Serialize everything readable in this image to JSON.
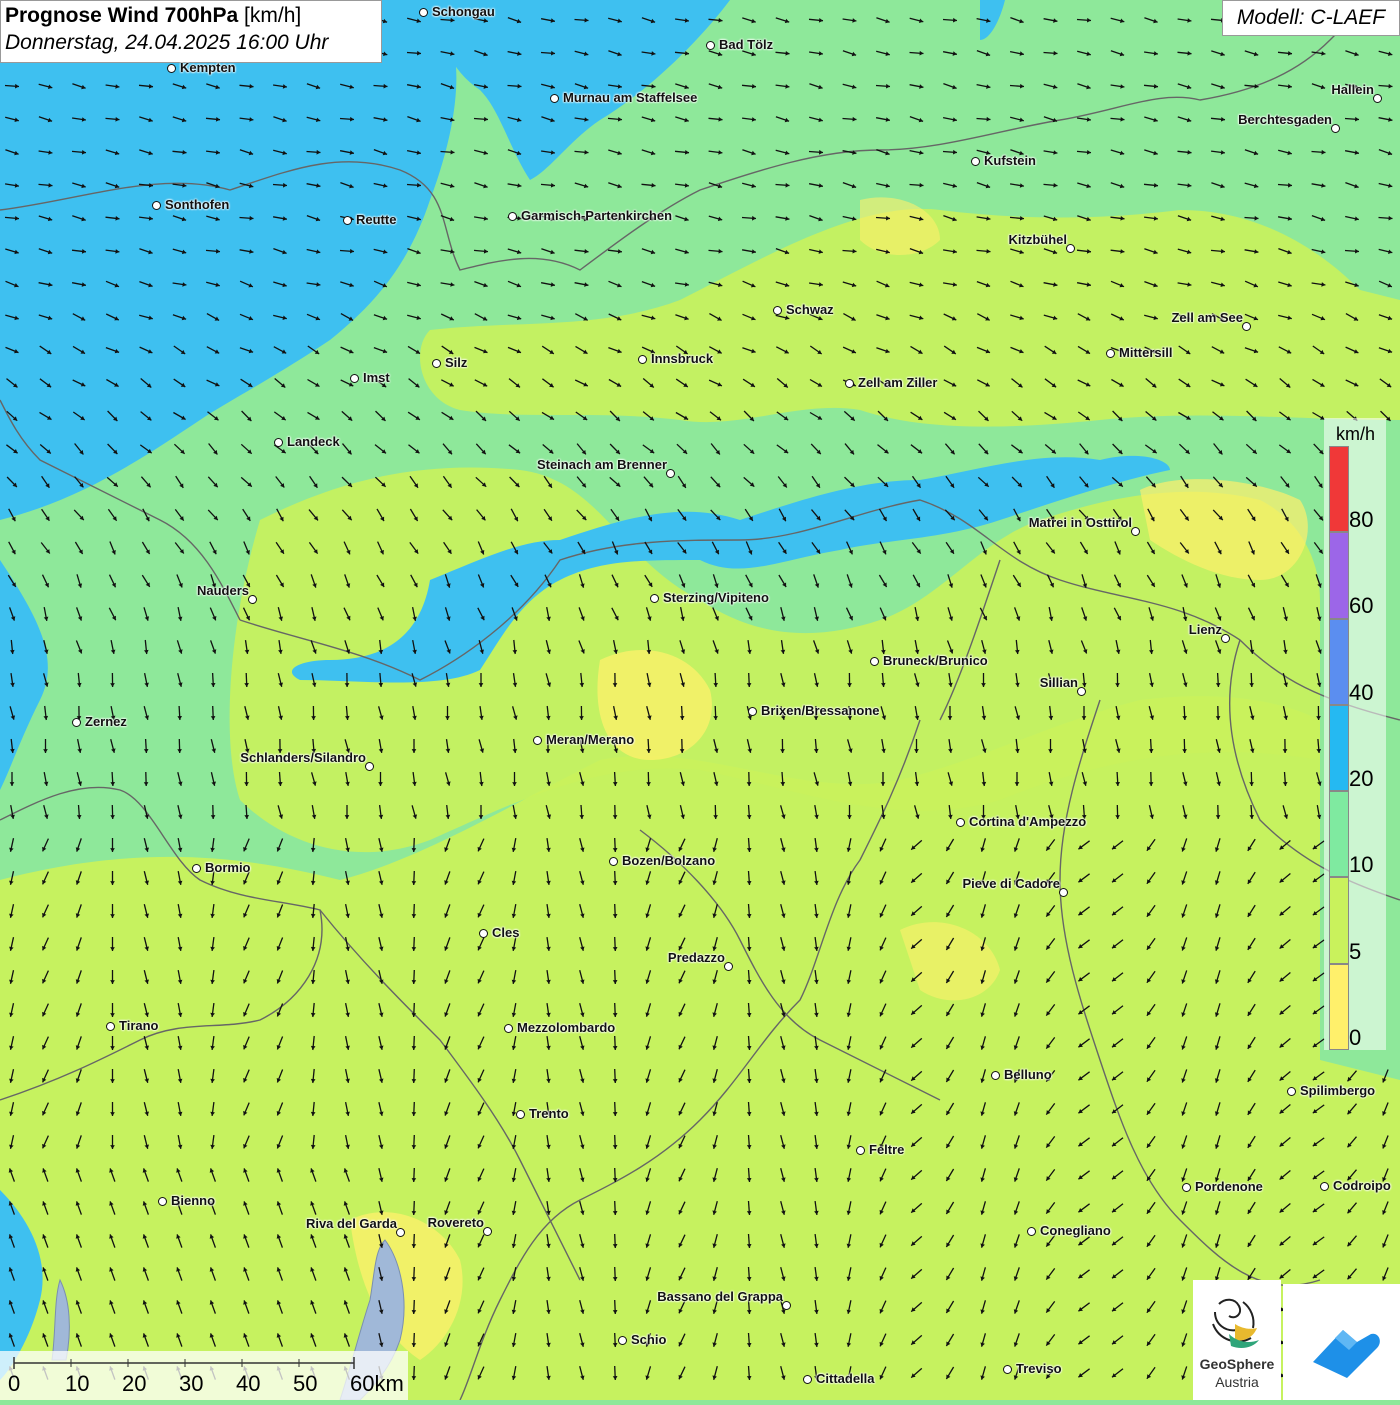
{
  "header": {
    "title_bold": "Prognose Wind 700hPa",
    "title_unit": "[km/h]",
    "datetime": "Donnerstag, 24.04.2025 16:00 Uhr",
    "model": "Modell: C-LAEF"
  },
  "legend": {
    "unit": "km/h",
    "classes": [
      {
        "min": 60,
        "max": 80,
        "color": "#9c66e8"
      },
      {
        "min": 40,
        "max": 60,
        "color": "#5b8ef0"
      },
      {
        "min": 20,
        "max": 40,
        "color": "#25b9f2"
      },
      {
        "min": 10,
        "max": 20,
        "color": "#7feaa0"
      },
      {
        "min": 5,
        "max": 10,
        "color": "#c9f25c"
      },
      {
        "min": 0,
        "max": 5,
        "color": "#fff06b"
      }
    ],
    "top_color": "#f03838",
    "labels": [
      "80",
      "60",
      "40",
      "20",
      "10",
      "5",
      "0"
    ]
  },
  "scale_bar": {
    "labels": [
      "0",
      "10",
      "20",
      "30",
      "40",
      "50",
      "60km"
    ]
  },
  "logo": {
    "name": "GeoSphere",
    "sub": "Austria",
    "icon": "geosphere-logo-icon",
    "secondary_icon": "warning-app-icon"
  },
  "cities": [
    {
      "name": "Schongau"
    },
    {
      "name": "Bad Tölz"
    },
    {
      "name": "Kempten"
    },
    {
      "name": "Murnau am Staffelsee"
    },
    {
      "name": "Hallein"
    },
    {
      "name": "Berchtesgaden"
    },
    {
      "name": "Kufstein"
    },
    {
      "name": "Sonthofen"
    },
    {
      "name": "Reutte"
    },
    {
      "name": "Garmisch-Partenkirchen"
    },
    {
      "name": "Kitzbühel"
    },
    {
      "name": "Schwaz"
    },
    {
      "name": "Zell am See"
    },
    {
      "name": "Innsbruck"
    },
    {
      "name": "Mittersill"
    },
    {
      "name": "Silz"
    },
    {
      "name": "Imst"
    },
    {
      "name": "Zell am Ziller"
    },
    {
      "name": "Landeck"
    },
    {
      "name": "Steinach am Brenner"
    },
    {
      "name": "Matrei in Osttirol"
    },
    {
      "name": "Nauders"
    },
    {
      "name": "Sterzing/Vipiteno"
    },
    {
      "name": "Lienz"
    },
    {
      "name": "Bruneck/Brunico"
    },
    {
      "name": "Sillian"
    },
    {
      "name": "Brixen/Bressanone"
    },
    {
      "name": "Zernez"
    },
    {
      "name": "Meran/Merano"
    },
    {
      "name": "Schlanders/Silandro"
    },
    {
      "name": "Cortina d'Ampezzo"
    },
    {
      "name": "Bozen/Bolzano"
    },
    {
      "name": "Bormio"
    },
    {
      "name": "Pieve di Cadore"
    },
    {
      "name": "Cles"
    },
    {
      "name": "Predazzo"
    },
    {
      "name": "Tirano"
    },
    {
      "name": "Mezzolombardo"
    },
    {
      "name": "Belluno"
    },
    {
      "name": "Spilimbergo"
    },
    {
      "name": "Trento"
    },
    {
      "name": "Feltre"
    },
    {
      "name": "Pordenone"
    },
    {
      "name": "Codroipo"
    },
    {
      "name": "Bienno"
    },
    {
      "name": "Riva del Garda"
    },
    {
      "name": "Rovereto"
    },
    {
      "name": "Conegliano"
    },
    {
      "name": "Bassano del Grappa"
    },
    {
      "name": "Schio"
    },
    {
      "name": "Treviso"
    },
    {
      "name": "Cittadella"
    }
  ],
  "colors": {
    "band_0_5": "#fff06b",
    "band_5_10": "#c9f25c",
    "band_10_20": "#8ee89a",
    "band_20_40": "#3ec0f0",
    "border_line": "#666666",
    "arrow": "#111111"
  }
}
